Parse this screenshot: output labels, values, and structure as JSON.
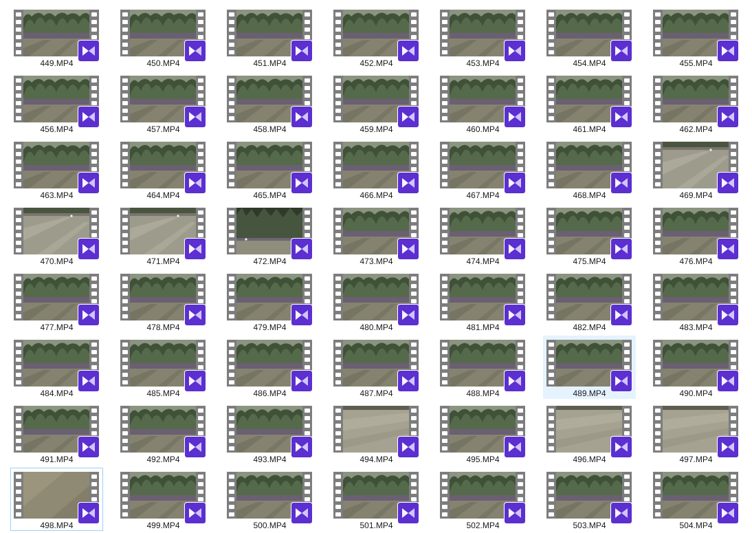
{
  "files": [
    {
      "name": "449.MP4",
      "scene": "trees"
    },
    {
      "name": "450.MP4",
      "scene": "trees"
    },
    {
      "name": "451.MP4",
      "scene": "trees"
    },
    {
      "name": "452.MP4",
      "scene": "trees"
    },
    {
      "name": "453.MP4",
      "scene": "trees"
    },
    {
      "name": "454.MP4",
      "scene": "trees"
    },
    {
      "name": "455.MP4",
      "scene": "trees"
    },
    {
      "name": "456.MP4",
      "scene": "trees"
    },
    {
      "name": "457.MP4",
      "scene": "trees"
    },
    {
      "name": "458.MP4",
      "scene": "trees"
    },
    {
      "name": "459.MP4",
      "scene": "trees"
    },
    {
      "name": "460.MP4",
      "scene": "trees"
    },
    {
      "name": "461.MP4",
      "scene": "trees"
    },
    {
      "name": "462.MP4",
      "scene": "trees"
    },
    {
      "name": "463.MP4",
      "scene": "trees"
    },
    {
      "name": "464.MP4",
      "scene": "trees"
    },
    {
      "name": "465.MP4",
      "scene": "trees"
    },
    {
      "name": "466.MP4",
      "scene": "trees"
    },
    {
      "name": "467.MP4",
      "scene": "trees"
    },
    {
      "name": "468.MP4",
      "scene": "trees"
    },
    {
      "name": "469.MP4",
      "scene": "field-far"
    },
    {
      "name": "470.MP4",
      "scene": "field-far"
    },
    {
      "name": "471.MP4",
      "scene": "field-far"
    },
    {
      "name": "472.MP4",
      "scene": "forest-tall"
    },
    {
      "name": "473.MP4",
      "scene": "trees"
    },
    {
      "name": "474.MP4",
      "scene": "trees"
    },
    {
      "name": "475.MP4",
      "scene": "trees"
    },
    {
      "name": "476.MP4",
      "scene": "trees"
    },
    {
      "name": "477.MP4",
      "scene": "trees"
    },
    {
      "name": "478.MP4",
      "scene": "trees"
    },
    {
      "name": "479.MP4",
      "scene": "trees"
    },
    {
      "name": "480.MP4",
      "scene": "trees"
    },
    {
      "name": "481.MP4",
      "scene": "trees"
    },
    {
      "name": "482.MP4",
      "scene": "trees"
    },
    {
      "name": "483.MP4",
      "scene": "trees"
    },
    {
      "name": "484.MP4",
      "scene": "trees"
    },
    {
      "name": "485.MP4",
      "scene": "trees"
    },
    {
      "name": "486.MP4",
      "scene": "trees"
    },
    {
      "name": "487.MP4",
      "scene": "trees"
    },
    {
      "name": "488.MP4",
      "scene": "trees"
    },
    {
      "name": "489.MP4",
      "scene": "trees",
      "state": "hover"
    },
    {
      "name": "490.MP4",
      "scene": "trees"
    },
    {
      "name": "491.MP4",
      "scene": "trees"
    },
    {
      "name": "492.MP4",
      "scene": "trees"
    },
    {
      "name": "493.MP4",
      "scene": "trees"
    },
    {
      "name": "494.MP4",
      "scene": "ground"
    },
    {
      "name": "495.MP4",
      "scene": "trees"
    },
    {
      "name": "496.MP4",
      "scene": "ground"
    },
    {
      "name": "497.MP4",
      "scene": "ground"
    },
    {
      "name": "498.MP4",
      "scene": "ground-close",
      "state": "selected"
    },
    {
      "name": "499.MP4",
      "scene": "trees"
    },
    {
      "name": "500.MP4",
      "scene": "trees"
    },
    {
      "name": "501.MP4",
      "scene": "trees"
    },
    {
      "name": "502.MP4",
      "scene": "trees"
    },
    {
      "name": "503.MP4",
      "scene": "trees"
    },
    {
      "name": "504.MP4",
      "scene": "trees"
    }
  ],
  "icons": {
    "thumbnail": "film-strip-icon",
    "badge": "media-player-play-icon"
  },
  "colors": {
    "badge": "#5b2fd0",
    "hover_background": "#e5f3ff",
    "selected_border": "#99d1ff",
    "film_reel": "#7d7d7d"
  }
}
